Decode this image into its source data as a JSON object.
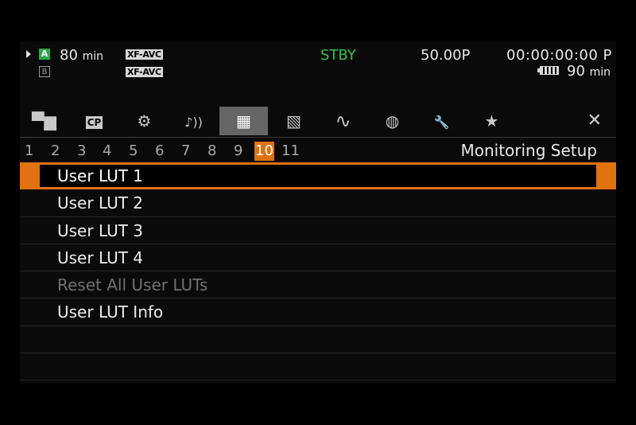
{
  "status": {
    "slot_a": "A",
    "slot_b": "B",
    "rec_time_a": "80",
    "rec_time_unit": "min",
    "format_a": "XF-AVC",
    "format_b": "XF-AVC",
    "mode": "STBY",
    "frame_rate": "50.00P",
    "timecode": "00:00:00:00 P",
    "battery_time": "90",
    "battery_unit": "min",
    "colors": {
      "standby": "#35c24a",
      "slot_a": "#2fa84a",
      "accent": "#e0720f"
    }
  },
  "tabs": [
    {
      "icon": "camera-icon",
      "glyph": "▀▆"
    },
    {
      "icon": "custom-picture-icon",
      "glyph": "CP"
    },
    {
      "icon": "camera-setup-icon",
      "glyph": "⚙"
    },
    {
      "icon": "audio-icon",
      "glyph": "♪))"
    },
    {
      "icon": "monitoring-setup-icon",
      "glyph": "▦",
      "active": true
    },
    {
      "icon": "recording-media-icon",
      "glyph": "▧"
    },
    {
      "icon": "network-icon",
      "glyph": "∿"
    },
    {
      "icon": "playback-icon",
      "glyph": "◍"
    },
    {
      "icon": "system-setup-icon",
      "glyph": "🔧"
    },
    {
      "icon": "my-menu-icon",
      "glyph": "★"
    }
  ],
  "close_glyph": "✕",
  "pages": [
    "1",
    "2",
    "3",
    "4",
    "5",
    "6",
    "7",
    "8",
    "9",
    "10",
    "11"
  ],
  "active_page": "10",
  "section_title": "Monitoring Setup",
  "menu": [
    {
      "label": "User LUT 1"
    },
    {
      "label": "User LUT 2"
    },
    {
      "label": "User LUT 3"
    },
    {
      "label": "User LUT 4"
    },
    {
      "label": "Reset All User LUTs"
    },
    {
      "label": "User LUT Info"
    },
    {
      "label": ""
    },
    {
      "label": ""
    }
  ]
}
